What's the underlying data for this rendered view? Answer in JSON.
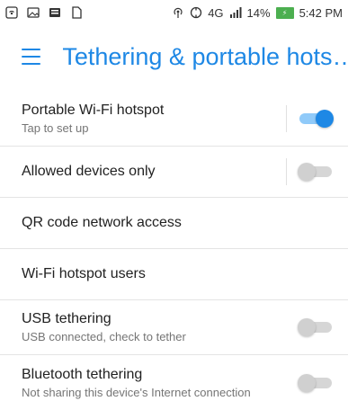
{
  "status_bar": {
    "left_icons": [
      "wifi-hotspot-icon",
      "image-icon",
      "news-icon",
      "sim-card-icon"
    ],
    "right_icons": [
      "hotspot-icon",
      "data-saver-icon",
      "signal-icon"
    ],
    "network": "4G",
    "battery": "14%",
    "time": "5:42 PM"
  },
  "toolbar": {
    "title": "Tethering & portable hots…",
    "menu_icon": "hamburger-icon"
  },
  "settings": [
    {
      "title": "Portable Wi-Fi hotspot",
      "subtitle": "Tap to set up",
      "toggle": "on"
    },
    {
      "title": "Allowed devices only",
      "toggle": "off"
    },
    {
      "title": "QR code network access"
    },
    {
      "title": "Wi-Fi hotspot users"
    },
    {
      "title": "USB tethering",
      "subtitle": "USB connected, check to tether",
      "toggle": "off"
    },
    {
      "title": "Bluetooth tethering",
      "subtitle": "Not sharing this device's Internet connection",
      "toggle": "off"
    }
  ],
  "colors": {
    "accent": "#1e88e5",
    "accent_light": "#90caf9",
    "divider": "#e4e4e4",
    "text_primary": "#212121",
    "text_secondary": "#757575"
  }
}
